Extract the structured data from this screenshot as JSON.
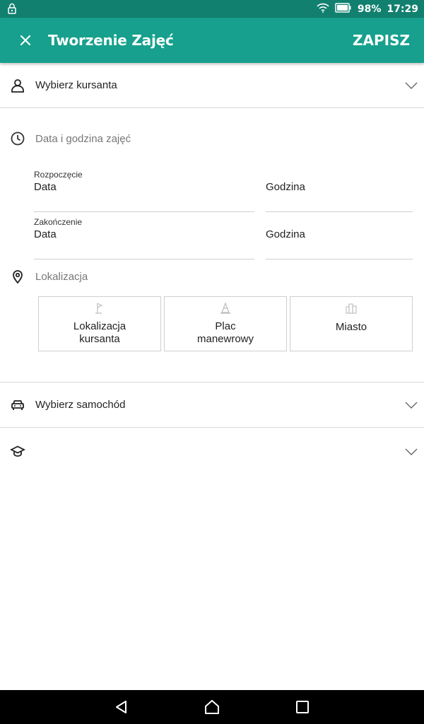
{
  "status_bar": {
    "battery": "98%",
    "time": "17:29",
    "icons": [
      "lock-icon",
      "wifi-icon",
      "battery-icon"
    ]
  },
  "app_bar": {
    "title": "Tworzenie Zajęć",
    "save_label": "ZAPISZ",
    "background_color": "#16a08d"
  },
  "student": {
    "label": "Wybierz kursanta"
  },
  "datetime": {
    "section_label": "Data i godzina zajęć",
    "start": {
      "label": "Rozpoczęcie",
      "date": "Data",
      "time": "Godzina"
    },
    "end": {
      "label": "Zakończenie",
      "date": "Data",
      "time": "Godzina"
    }
  },
  "location": {
    "section_label": "Lokalizacja",
    "options": [
      {
        "line1": "Lokalizacja",
        "line2": "kursanta",
        "icon": "flag-icon"
      },
      {
        "line1": "Plac",
        "line2": "manewrowy",
        "icon": "traffic-cone-icon"
      },
      {
        "line1": "Miasto",
        "line2": "",
        "icon": "city-icon"
      }
    ]
  },
  "car": {
    "label": "Wybierz samochód"
  },
  "category": {
    "label": ""
  }
}
